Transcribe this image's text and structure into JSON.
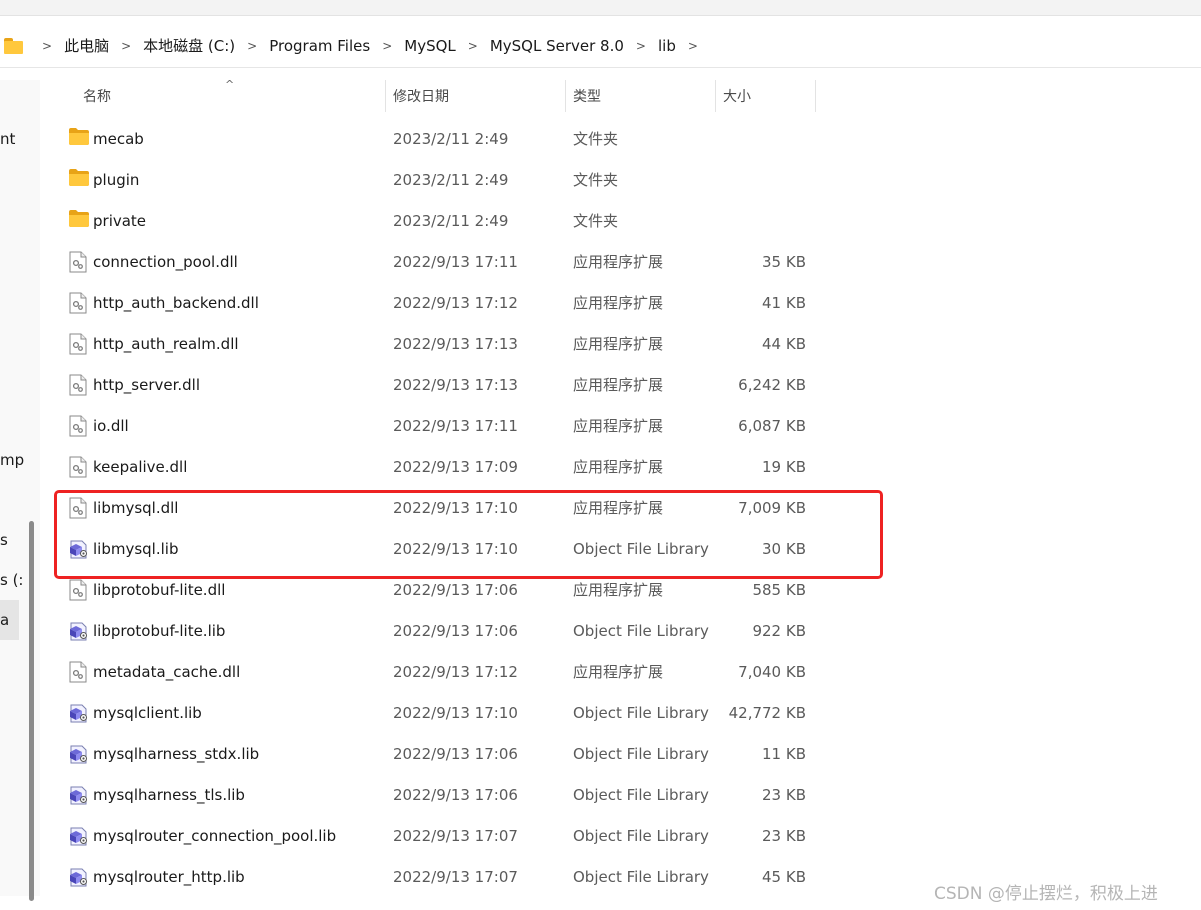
{
  "breadcrumb": {
    "items": [
      "此电脑",
      "本地磁盘 (C:)",
      "Program Files",
      "MySQL",
      "MySQL Server 8.0",
      "lib"
    ]
  },
  "nav_pane": {
    "partial_labels": [
      "nt",
      "mp",
      "s",
      "s (:",
      "a"
    ]
  },
  "columns": {
    "name": "名称",
    "date": "修改日期",
    "type": "类型",
    "size": "大小"
  },
  "files": [
    {
      "name": "mecab",
      "date": "2023/2/11 2:49",
      "type": "文件夹",
      "size": "",
      "icon": "folder-icon"
    },
    {
      "name": "plugin",
      "date": "2023/2/11 2:49",
      "type": "文件夹",
      "size": "",
      "icon": "folder-icon"
    },
    {
      "name": "private",
      "date": "2023/2/11 2:49",
      "type": "文件夹",
      "size": "",
      "icon": "folder-icon"
    },
    {
      "name": "connection_pool.dll",
      "date": "2022/9/13 17:11",
      "type": "应用程序扩展",
      "size": "35 KB",
      "icon": "dll-file-icon"
    },
    {
      "name": "http_auth_backend.dll",
      "date": "2022/9/13 17:12",
      "type": "应用程序扩展",
      "size": "41 KB",
      "icon": "dll-file-icon"
    },
    {
      "name": "http_auth_realm.dll",
      "date": "2022/9/13 17:13",
      "type": "应用程序扩展",
      "size": "44 KB",
      "icon": "dll-file-icon"
    },
    {
      "name": "http_server.dll",
      "date": "2022/9/13 17:13",
      "type": "应用程序扩展",
      "size": "6,242 KB",
      "icon": "dll-file-icon"
    },
    {
      "name": "io.dll",
      "date": "2022/9/13 17:11",
      "type": "应用程序扩展",
      "size": "6,087 KB",
      "icon": "dll-file-icon"
    },
    {
      "name": "keepalive.dll",
      "date": "2022/9/13 17:09",
      "type": "应用程序扩展",
      "size": "19 KB",
      "icon": "dll-file-icon"
    },
    {
      "name": "libmysql.dll",
      "date": "2022/9/13 17:10",
      "type": "应用程序扩展",
      "size": "7,009 KB",
      "icon": "dll-file-icon"
    },
    {
      "name": "libmysql.lib",
      "date": "2022/9/13 17:10",
      "type": "Object File Library",
      "size": "30 KB",
      "icon": "lib-file-icon"
    },
    {
      "name": "libprotobuf-lite.dll",
      "date": "2022/9/13 17:06",
      "type": "应用程序扩展",
      "size": "585 KB",
      "icon": "dll-file-icon"
    },
    {
      "name": "libprotobuf-lite.lib",
      "date": "2022/9/13 17:06",
      "type": "Object File Library",
      "size": "922 KB",
      "icon": "lib-file-icon"
    },
    {
      "name": "metadata_cache.dll",
      "date": "2022/9/13 17:12",
      "type": "应用程序扩展",
      "size": "7,040 KB",
      "icon": "dll-file-icon"
    },
    {
      "name": "mysqlclient.lib",
      "date": "2022/9/13 17:10",
      "type": "Object File Library",
      "size": "42,772 KB",
      "icon": "lib-file-icon"
    },
    {
      "name": "mysqlharness_stdx.lib",
      "date": "2022/9/13 17:06",
      "type": "Object File Library",
      "size": "11 KB",
      "icon": "lib-file-icon"
    },
    {
      "name": "mysqlharness_tls.lib",
      "date": "2022/9/13 17:06",
      "type": "Object File Library",
      "size": "23 KB",
      "icon": "lib-file-icon"
    },
    {
      "name": "mysqlrouter_connection_pool.lib",
      "date": "2022/9/13 17:07",
      "type": "Object File Library",
      "size": "23 KB",
      "icon": "lib-file-icon"
    },
    {
      "name": "mysqlrouter_http.lib",
      "date": "2022/9/13 17:07",
      "type": "Object File Library",
      "size": "45 KB",
      "icon": "lib-file-icon"
    }
  ],
  "highlight_color": "#ee2222",
  "watermark": "CSDN @停止摆烂，积极上进"
}
